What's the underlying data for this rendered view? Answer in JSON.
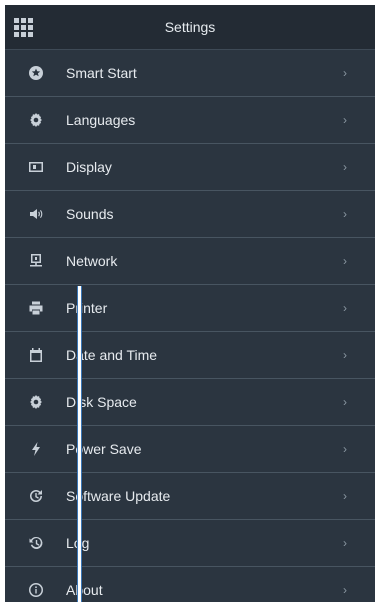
{
  "header": {
    "title": "Settings",
    "menu_icon": "apps-grid-icon"
  },
  "items": [
    {
      "label": "Smart Start",
      "icon": "smart-start-icon"
    },
    {
      "label": "Languages",
      "icon": "gear-icon"
    },
    {
      "label": "Display",
      "icon": "display-icon"
    },
    {
      "label": "Sounds",
      "icon": "speaker-icon"
    },
    {
      "label": "Network",
      "icon": "network-icon"
    },
    {
      "label": "Printer",
      "icon": "printer-icon"
    },
    {
      "label": "Date and Time",
      "icon": "calendar-icon"
    },
    {
      "label": "Disk Space",
      "icon": "gear-icon"
    },
    {
      "label": "Power Save",
      "icon": "lightning-icon"
    },
    {
      "label": "Software Update",
      "icon": "update-icon"
    },
    {
      "label": "Log",
      "icon": "history-icon"
    },
    {
      "label": "About",
      "icon": "info-icon"
    }
  ],
  "chevron": "›"
}
